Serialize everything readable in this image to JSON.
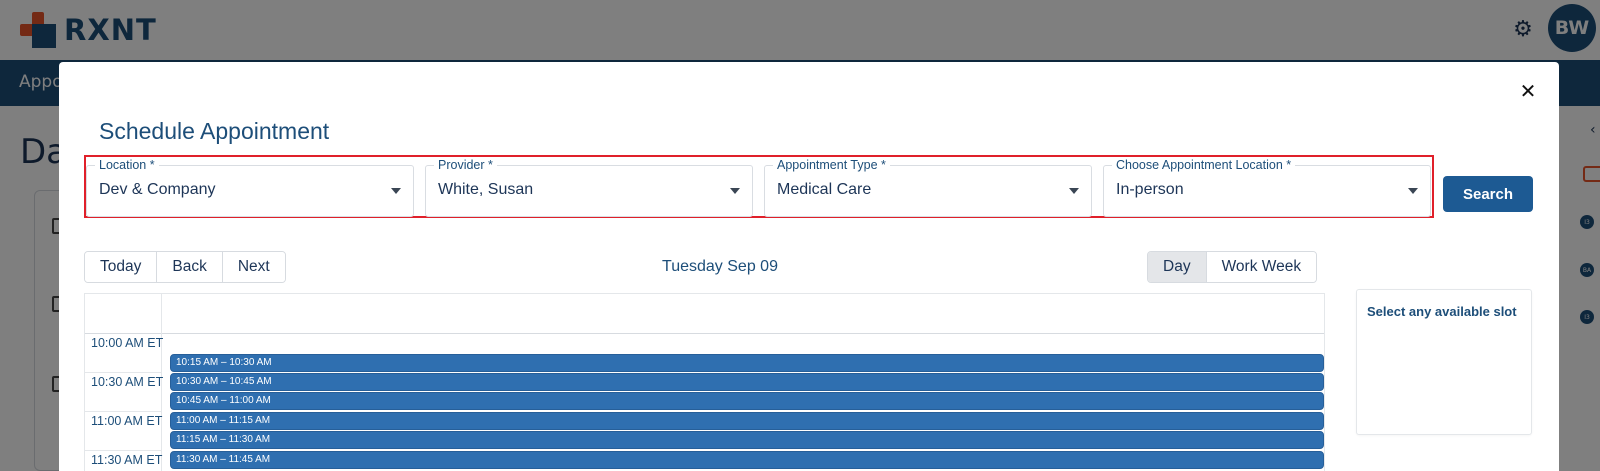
{
  "app": {
    "brand": "RXNT",
    "avatar_initials": "BW",
    "nav_item": "Appo",
    "heading": "Da",
    "right_badges": [
      "I3",
      "BA",
      "I3"
    ]
  },
  "modal": {
    "title": "Schedule Appointment",
    "close_icon": "close-icon",
    "fields": [
      {
        "label": "Location *",
        "value": "Dev & Company"
      },
      {
        "label": "Provider *",
        "value": "White, Susan"
      },
      {
        "label": "Appointment Type *",
        "value": "Medical Care"
      },
      {
        "label": "Choose Appointment Location *",
        "value": "In-person"
      }
    ],
    "search_label": "Search",
    "highlight_color": "#e0202a"
  },
  "toolbar": {
    "today": "Today",
    "back": "Back",
    "next": "Next",
    "date": "Tuesday Sep 09",
    "day": "Day",
    "work_week": "Work Week",
    "active_view": "Day"
  },
  "calendar": {
    "time_labels": [
      "10:00 AM ET",
      "10:30 AM ET",
      "11:00 AM ET",
      "11:30 AM ET"
    ],
    "slots": [
      "10:15 AM – 10:30 AM",
      "10:30 AM – 10:45 AM",
      "10:45 AM – 11:00 AM",
      "11:00 AM – 11:15 AM",
      "11:15 AM – 11:30 AM",
      "11:30 AM – 11:45 AM"
    ],
    "slot_color": "#2f6fb0"
  },
  "side_panel": {
    "message": "Select any available slot"
  }
}
